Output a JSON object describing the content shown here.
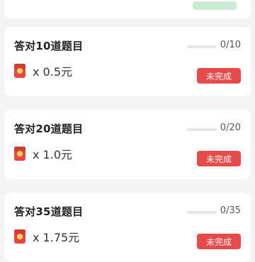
{
  "colors": {
    "accent_red": "#e84a4a",
    "card_bg": "#ffffff",
    "page_bg": "#f4f4f4",
    "green_button": "#c8ecd3"
  },
  "tasks": [
    {
      "title": "答对10道题目",
      "reward_text": "x 0.5元",
      "progress_text": "0/10",
      "progress": 0,
      "status": "未完成",
      "icon": "red-packet-icon"
    },
    {
      "title": "答对20道题目",
      "reward_text": "x 1.0元",
      "progress_text": "0/20",
      "progress": 0,
      "status": "未完成",
      "icon": "red-packet-icon"
    },
    {
      "title": "答对35道题目",
      "reward_text": "x 1.75元",
      "progress_text": "0/35",
      "progress": 0,
      "status": "未完成",
      "icon": "red-packet-icon"
    }
  ]
}
